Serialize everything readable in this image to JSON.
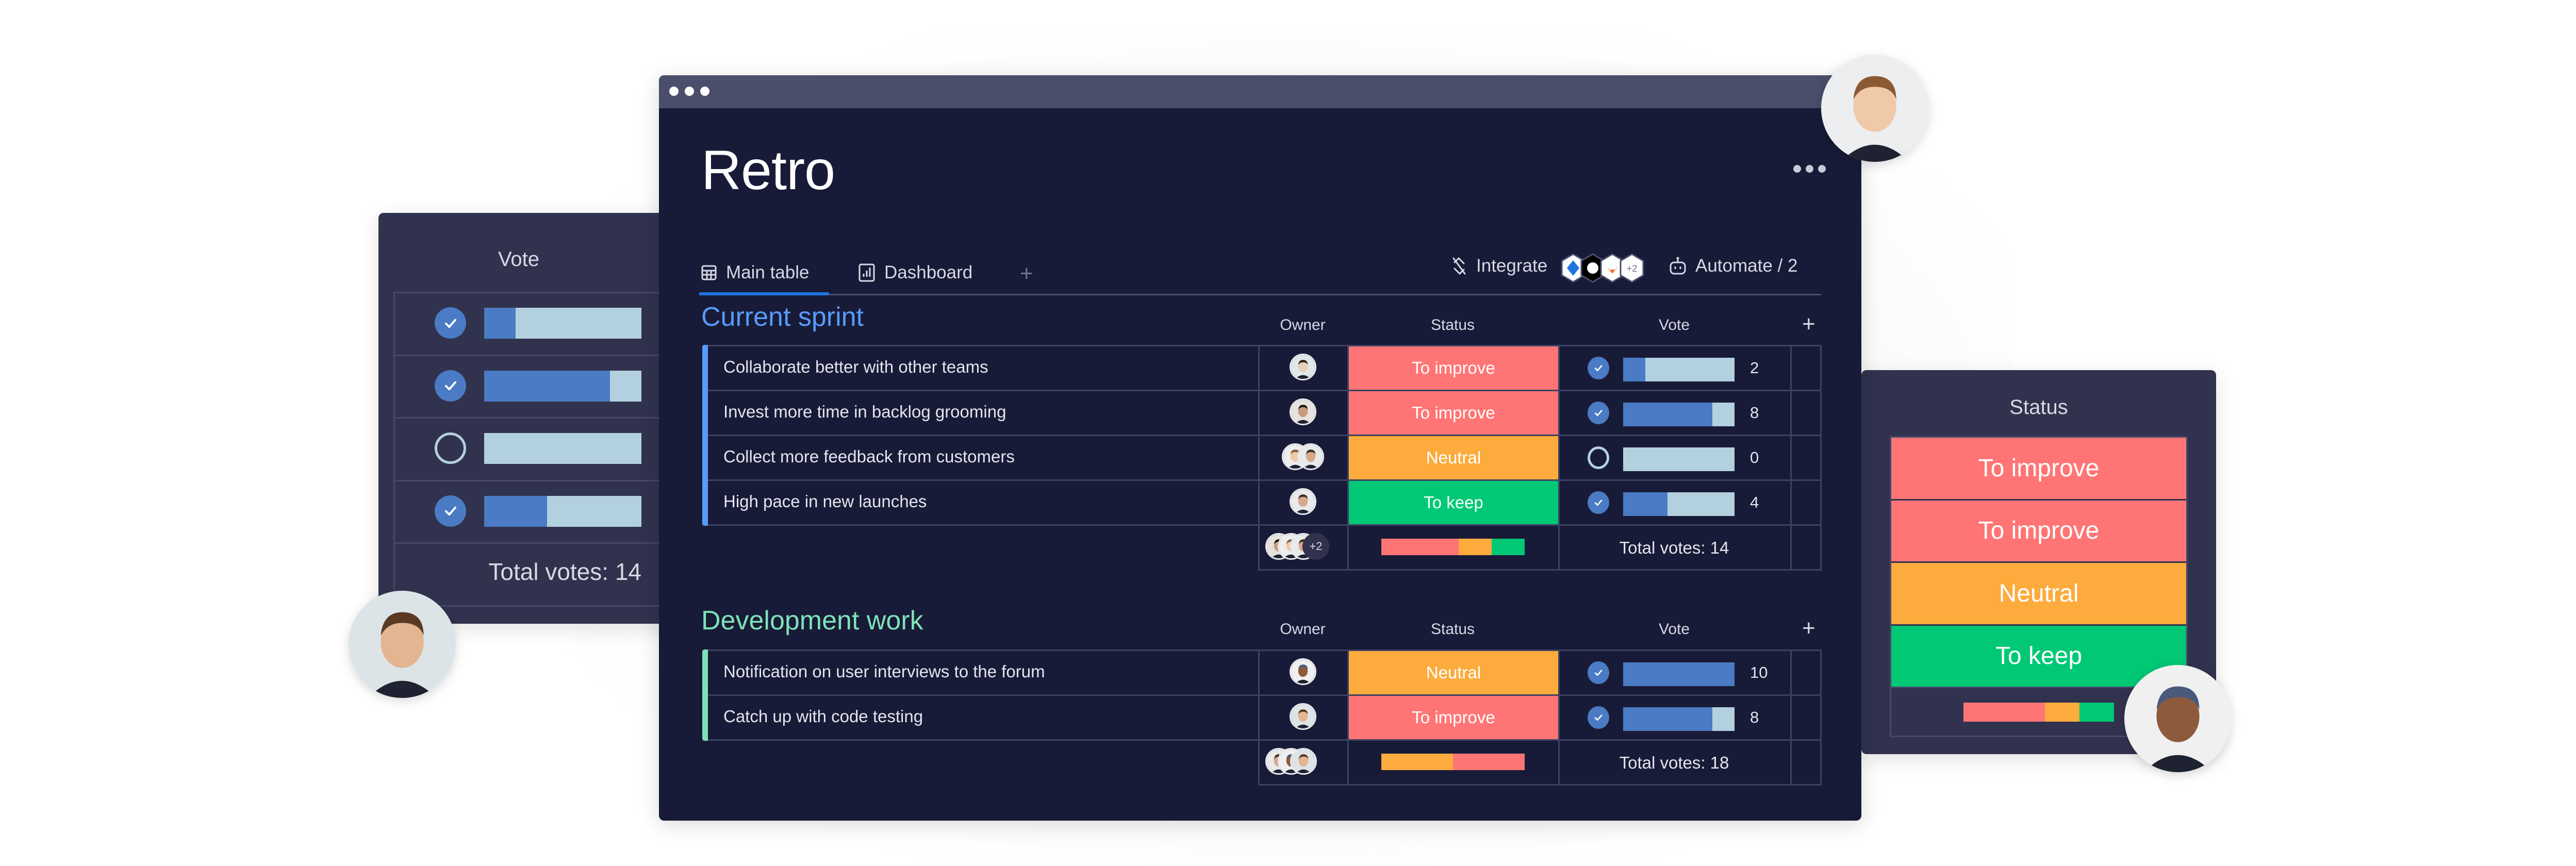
{
  "colors": {
    "window_bg": "#181b37",
    "titlebar_bg": "#4a4e6a",
    "panel_bg": "#31324e",
    "to_improve": "#ff7575",
    "neutral": "#fdab3d",
    "to_keep": "#00c875",
    "vote_fill": "#4a7bc4",
    "vote_track": "#b3d0de",
    "current_sprint_accent": "#579bfc",
    "development_accent": "#7ee2b8",
    "tab_active": "#1f74e2"
  },
  "board": {
    "title": "Retro",
    "more_menu": "more-options"
  },
  "tabs": [
    {
      "label": "Main table",
      "icon": "table-icon",
      "active": true
    },
    {
      "label": "Dashboard",
      "icon": "chart-icon",
      "active": false
    }
  ],
  "tab_add_label": "+",
  "toolbar": {
    "integrate_label": "Integrate",
    "integrations": [
      "jira",
      "github",
      "gitlab"
    ],
    "integrations_more": "+2",
    "automate_label": "Automate / 2"
  },
  "columns": {
    "owner": "Owner",
    "status": "Status",
    "vote": "Vote",
    "add": "+"
  },
  "groups": [
    {
      "title": "Current sprint",
      "accent": "#579bfc",
      "items": [
        {
          "name": "Collaborate better with other teams",
          "owners": 1,
          "status": "To improve",
          "status_color": "#ff7575",
          "voted": true,
          "votes": 2
        },
        {
          "name": "Invest more time in backlog grooming",
          "owners": 1,
          "status": "To improve",
          "status_color": "#ff7575",
          "voted": true,
          "votes": 8
        },
        {
          "name": "Collect more feedback from customers",
          "owners": 2,
          "status": "Neutral",
          "status_color": "#fdab3d",
          "voted": false,
          "votes": 0
        },
        {
          "name": "High pace in new  launches",
          "owners": 1,
          "status": "To keep",
          "status_color": "#00c875",
          "voted": true,
          "votes": 4
        }
      ],
      "summary": {
        "owners_more": "+2",
        "status_distribution": [
          {
            "status": "To improve",
            "fraction": 0.54,
            "color": "#ff7575"
          },
          {
            "status": "Neutral",
            "fraction": 0.23,
            "color": "#fdab3d"
          },
          {
            "status": "To keep",
            "fraction": 0.23,
            "color": "#00c875"
          }
        ],
        "total_votes": "Total votes: 14"
      }
    },
    {
      "title": "Development work",
      "accent": "#7ee2b8",
      "items": [
        {
          "name": "Notification on user interviews to the forum",
          "owners": 1,
          "status": "Neutral",
          "status_color": "#fdab3d",
          "voted": true,
          "votes": 10
        },
        {
          "name": "Catch up with code testing",
          "owners": 1,
          "status": "To improve",
          "status_color": "#ff7575",
          "voted": true,
          "votes": 8
        }
      ],
      "summary": {
        "status_distribution": [
          {
            "status": "Neutral",
            "fraction": 0.5,
            "color": "#fdab3d"
          },
          {
            "status": "To improve",
            "fraction": 0.5,
            "color": "#ff7575"
          }
        ],
        "total_votes": "Total votes: 18"
      }
    }
  ],
  "vote_scale_max": 10,
  "vote_panel": {
    "title": "Vote",
    "rows": [
      {
        "voted": true,
        "votes": 2
      },
      {
        "voted": true,
        "votes": 8
      },
      {
        "voted": false,
        "votes": 0
      },
      {
        "voted": true,
        "votes": 4
      }
    ],
    "total": "Total votes: 14"
  },
  "status_panel": {
    "title": "Status",
    "rows": [
      {
        "label": "To improve",
        "color": "#ff7575"
      },
      {
        "label": "To improve",
        "color": "#ff7575"
      },
      {
        "label": "Neutral",
        "color": "#fdab3d"
      },
      {
        "label": "To keep",
        "color": "#00c875"
      }
    ],
    "distribution": [
      {
        "status": "To improve",
        "fraction": 0.54,
        "color": "#ff7575"
      },
      {
        "status": "Neutral",
        "fraction": 0.23,
        "color": "#fdab3d"
      },
      {
        "status": "To keep",
        "fraction": 0.23,
        "color": "#00c875"
      }
    ]
  }
}
